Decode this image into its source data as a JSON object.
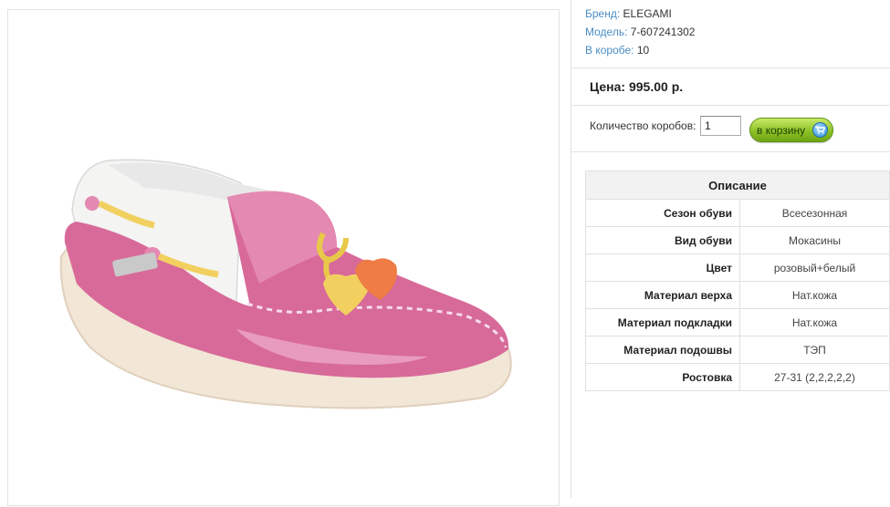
{
  "product": {
    "image_alt": "Розовые мокасины ELEGAMI",
    "meta": [
      {
        "label": "Бренд:",
        "value": "ELEGAMI"
      },
      {
        "label": "Модель:",
        "value": "7-607241302"
      },
      {
        "label": "В коробе:",
        "value": "10"
      }
    ],
    "price": "Цена: 995.00 р."
  },
  "order": {
    "qty_label": "Количество коробов:",
    "qty_value": "1",
    "cart_button_label": "в корзину",
    "cart_icon": "cart-icon"
  },
  "description": {
    "title": "Описание",
    "rows": [
      {
        "name": "Сезон обуви",
        "value": "Всесезонная"
      },
      {
        "name": "Вид обуви",
        "value": "Мокасины"
      },
      {
        "name": "Цвет",
        "value": "розовый+белый"
      },
      {
        "name": "Материал верха",
        "value": "Нат.кожа"
      },
      {
        "name": "Материал подкладки",
        "value": "Нат.кожа"
      },
      {
        "name": "Материал подошвы",
        "value": "ТЭП"
      },
      {
        "name": "Ростовка",
        "value": "27-31 (2,2,2,2,2)"
      }
    ]
  },
  "colors": {
    "link": "#4a8dc5",
    "button": "#8dc226",
    "shoe": "#d86a9a"
  }
}
